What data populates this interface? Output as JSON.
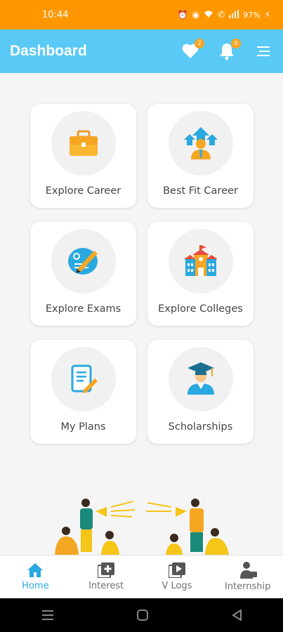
{
  "status_bar": {
    "time": "10:44",
    "battery": "97%"
  },
  "app_bar": {
    "title": "Dashboard",
    "wishlist_count": "2",
    "notification_count": "0"
  },
  "cards": [
    {
      "label": "Explore Career",
      "icon": "briefcase-icon"
    },
    {
      "label": "Best Fit Career",
      "icon": "career-growth-icon"
    },
    {
      "label": "Explore Exams",
      "icon": "exam-icon"
    },
    {
      "label": "Explore Colleges",
      "icon": "college-building-icon"
    },
    {
      "label": "My Plans",
      "icon": "plan-document-icon"
    },
    {
      "label": "Scholarships",
      "icon": "graduate-icon"
    }
  ],
  "bottom_nav": [
    {
      "label": "Home",
      "icon": "home-icon",
      "active": true
    },
    {
      "label": "Interest",
      "icon": "interest-add-icon",
      "active": false
    },
    {
      "label": "V Logs",
      "icon": "vlog-icon",
      "active": false
    },
    {
      "label": "Internship",
      "icon": "internship-icon",
      "active": false
    }
  ],
  "colors": {
    "status_bar": "#ff9800",
    "app_bar": "#5ac9f5",
    "accent": "#2aa8e0",
    "badge": "#f5a623"
  }
}
